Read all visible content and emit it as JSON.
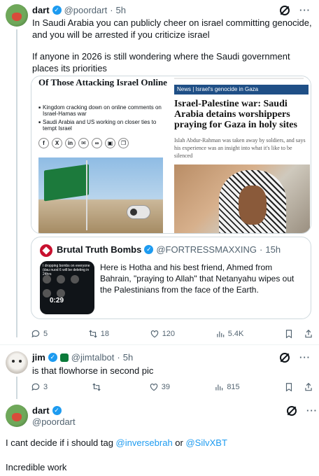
{
  "post1": {
    "name": "dart",
    "handle": "@poordart",
    "time": "5h",
    "text_line1": "In Saudi Arabia you can publicly cheer on israel committing genocide, and you will be arrested if you criticize israel",
    "text_line2": "If anyone in 2026 is still wondering where the Saudi government places its priorities",
    "media": {
      "left_headline": "Of Those Attacking Israel Online",
      "left_bullets": [
        "Kingdom cracking down on online comments on Israel-Hamas war",
        "Saudi Arabia and US working on closer ties to tempt Israel"
      ],
      "right_tag": "News | Israel's genocide in Gaza",
      "right_headline": "Israel-Palestine war: Saudi Arabia detains worshippers praying for Gaza in holy sites",
      "right_sub": "Islah Abdur-Rahman was taken away by soldiers, and says his experience was an insight into what it's like to be silenced"
    },
    "quote": {
      "name": "Brutal Truth Bombs",
      "handle": "@FORTRESSMAXXING",
      "time": "15h",
      "text": "Here is Hotha and his best friend, Ahmed from Bahrain, \"praying to Allah\" that Netanyahu wipes out the Palestinians from the face of the Earth.",
      "thumb_caption": "I dropping bombs on everyone (dau nuod 6 will be deleting in 24hrs",
      "video_time": "0:29"
    },
    "stats": {
      "replies": "5",
      "reposts": "18",
      "likes": "120",
      "views": "5.4K"
    }
  },
  "post2": {
    "name": "jim",
    "handle": "@jimtalbot",
    "time": "5h",
    "text": "is that flowhorse in second pic",
    "stats": {
      "replies": "3",
      "reposts": "",
      "likes": "39",
      "views": "815"
    }
  },
  "post3": {
    "name": "dart",
    "handle": "@poordart",
    "text_prefix": "I cant decide if i should tag ",
    "mention1": "@inversebrah",
    "text_mid": " or ",
    "mention2": "@SilvXBT",
    "text2": "Incredible work"
  },
  "icons": {
    "more": "more-icon",
    "grok": "grok-icon",
    "reply": "reply-icon",
    "repost": "repost-icon",
    "like": "like-icon",
    "views": "views-icon",
    "bookmark": "bookmark-icon",
    "share": "share-icon"
  },
  "colors": {
    "accent": "#1d9bf0",
    "muted": "#536471",
    "text": "#0f1419"
  }
}
